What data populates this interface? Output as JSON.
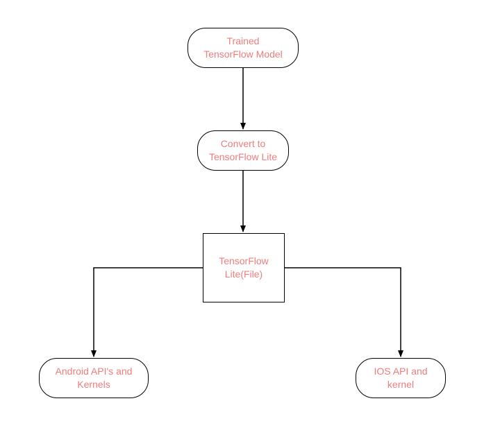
{
  "diagram": {
    "nodes": {
      "trained": "Trained\nTensorFlow Model",
      "convert": "Convert to\nTensorFlow Lite",
      "file": "TensorFlow\nLite(File)",
      "android": "Android API's and\nKernels",
      "ios": "IOS API and\nkernel"
    },
    "colors": {
      "text": "#f07d7d",
      "stroke": "#000000",
      "bg": "#ffffff"
    },
    "edges": [
      {
        "from": "trained",
        "to": "convert"
      },
      {
        "from": "convert",
        "to": "file"
      },
      {
        "from": "file",
        "to": "android"
      },
      {
        "from": "file",
        "to": "ios"
      }
    ]
  }
}
